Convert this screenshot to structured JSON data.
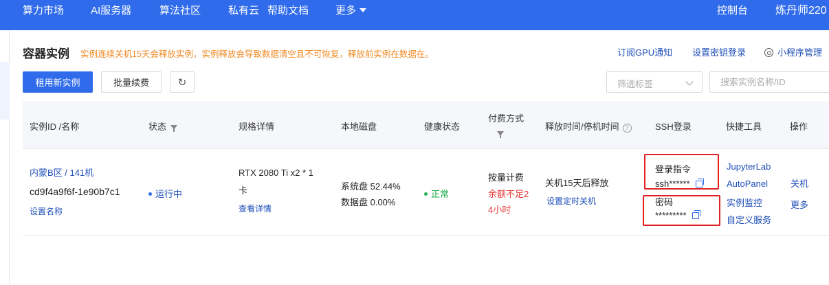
{
  "nav": {
    "items": [
      "算力市场",
      "AI服务器",
      "算法社区",
      "私有云",
      "帮助文档",
      "更多"
    ],
    "console": "控制台",
    "user": "炼丹师220"
  },
  "page": {
    "title": "容器实例",
    "notice": "实例连续关机15天会释放实例，实例释放会导致数据清空且不可恢复，释放前实例在数据在。",
    "links": {
      "gpu_notify": "订阅GPU通知",
      "ssh_key": "设置密钥登录",
      "miniprogram": "小程序管理"
    }
  },
  "toolbar": {
    "new_instance": "租用新实例",
    "batch_renew": "批量续费",
    "refresh_icon": "refresh-icon",
    "tag_filter_placeholder": "筛选标签",
    "search_placeholder": "搜索实例名称/ID"
  },
  "table": {
    "headers": {
      "id_name": "实例ID /名称",
      "status": "状态",
      "spec": "规格详情",
      "disk": "本地磁盘",
      "health": "健康状态",
      "billing": "付费方式",
      "release": "释放时间/停机时间",
      "ssh": "SSH登录",
      "tools": "快捷工具",
      "ops": "操作"
    },
    "row": {
      "region": "内蒙B区 / 141机",
      "id": "cd9f4a9f6f-1e90b7c1",
      "set_name": "设置名称",
      "status": "运行中",
      "spec_line1": "RTX 2080 Ti x2 * 1",
      "spec_line2": "卡",
      "spec_detail": "查看详情",
      "disk_system": "系统盘 52.44%",
      "disk_data": "数据盘 0.00%",
      "health": "正常",
      "billing_type": "按量计费",
      "billing_warn_1": "余额不足2",
      "billing_warn_2": "4小时",
      "release_info": "关机15天后释放",
      "set_shutdown": "设置定时关机",
      "ssh_cmd_label": "登录指令",
      "ssh_cmd_value": "ssh******",
      "password_label": "密码",
      "password_value": "*********",
      "tools": [
        "JupyterLab",
        "AutoPanel",
        "实例监控",
        "自定义服务"
      ],
      "ops": [
        "关机",
        "更多"
      ]
    }
  },
  "colors": {
    "primary": "#2f6bea",
    "link": "#1f4fb8",
    "warning": "#f08a24",
    "danger": "#e53935",
    "success": "#22b14c",
    "highlight": "#e02020"
  }
}
